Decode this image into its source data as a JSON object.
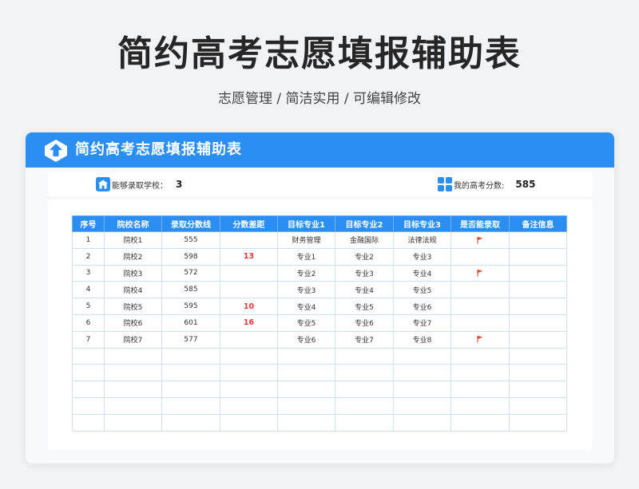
{
  "hero": {
    "title": "简约高考志愿填报辅助表",
    "subtitle": "志愿管理 / 简洁实用 /  可编辑修改"
  },
  "card": {
    "title": "简约高考志愿填报辅助表",
    "admit_label": "能够录取学校：",
    "admit_value": "3",
    "score_label": "我的高考分数:",
    "score_value": "585",
    "accent_color": "#2b8ef3"
  },
  "table": {
    "headers": [
      "序号",
      "院校名称",
      "录取分数线",
      "分数差距",
      "目标专业1",
      "目标专业2",
      "目标专业3",
      "是否能录取",
      "备注信息"
    ],
    "rows": [
      {
        "no": "1",
        "school": "院校1",
        "line": "555",
        "diff": "",
        "m1": "财务管理",
        "m2": "金融国际",
        "m3": "法律法规",
        "flag": true,
        "note": ""
      },
      {
        "no": "2",
        "school": "院校2",
        "line": "598",
        "diff": "13",
        "m1": "专业1",
        "m2": "专业2",
        "m3": "专业3",
        "flag": false,
        "note": ""
      },
      {
        "no": "3",
        "school": "院校3",
        "line": "572",
        "diff": "",
        "m1": "专业2",
        "m2": "专业3",
        "m3": "专业4",
        "flag": true,
        "note": ""
      },
      {
        "no": "4",
        "school": "院校4",
        "line": "585",
        "diff": "",
        "m1": "专业3",
        "m2": "专业4",
        "m3": "专业5",
        "flag": false,
        "note": ""
      },
      {
        "no": "5",
        "school": "院校5",
        "line": "595",
        "diff": "10",
        "m1": "专业4",
        "m2": "专业5",
        "m3": "专业6",
        "flag": false,
        "note": ""
      },
      {
        "no": "6",
        "school": "院校6",
        "line": "601",
        "diff": "16",
        "m1": "专业5",
        "m2": "专业6",
        "m3": "专业7",
        "flag": false,
        "note": ""
      },
      {
        "no": "7",
        "school": "院校7",
        "line": "577",
        "diff": "",
        "m1": "专业6",
        "m2": "专业7",
        "m3": "专业8",
        "flag": true,
        "note": ""
      }
    ],
    "empty_rows": 5,
    "flag_icon": "red-flag-icon"
  }
}
